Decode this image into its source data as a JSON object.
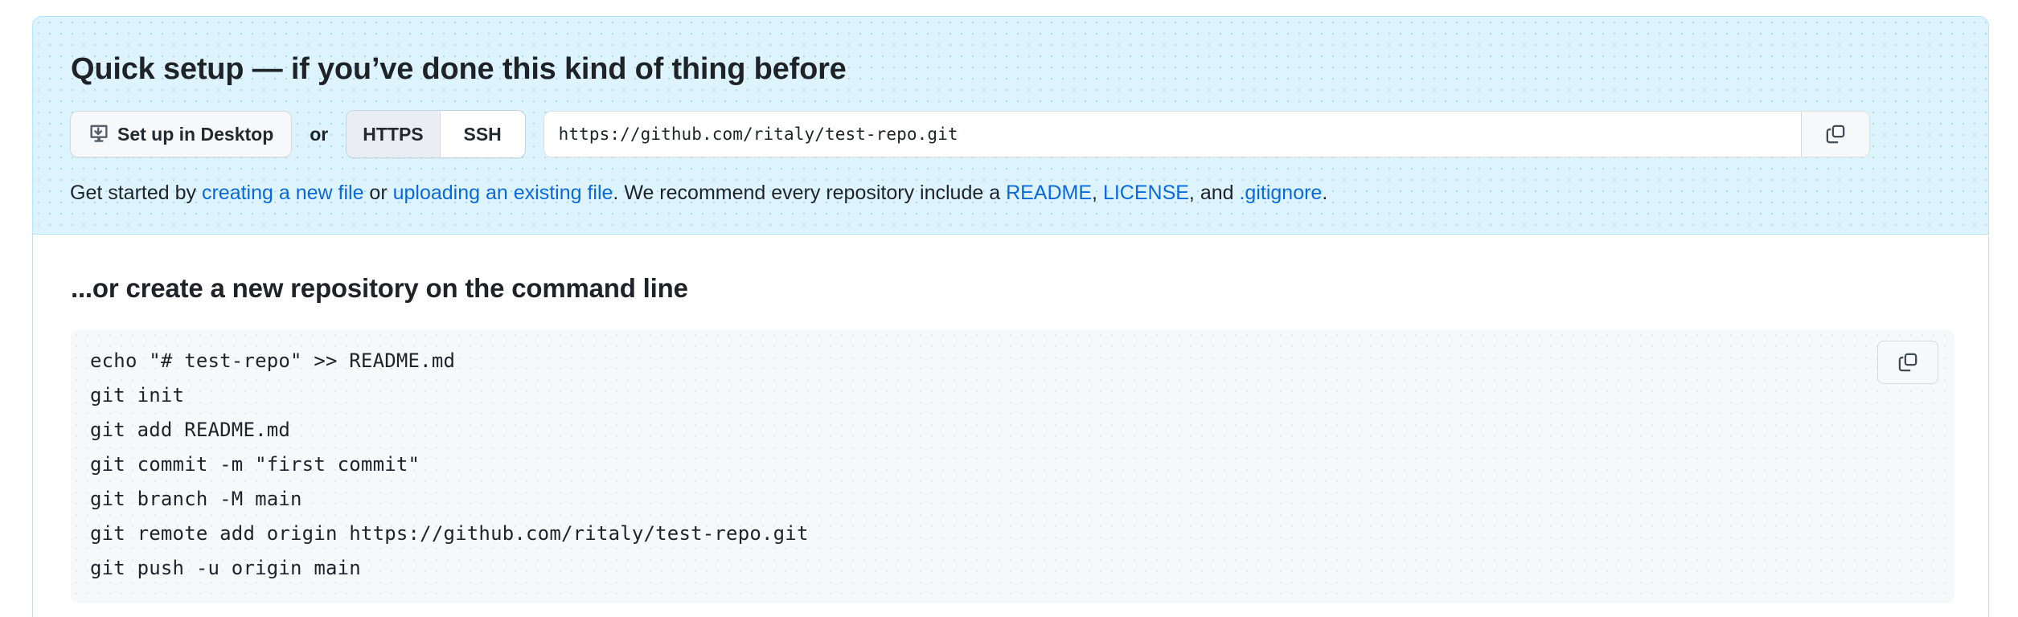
{
  "quick_setup": {
    "title": "Quick setup — if you’ve done this kind of thing before",
    "desktop_button": {
      "label": "Set up in Desktop",
      "icon": "desktop-download-icon"
    },
    "or_label": "or",
    "protocols": [
      {
        "label": "HTTPS",
        "selected": true
      },
      {
        "label": "SSH",
        "selected": false
      }
    ],
    "clone_url": "https://github.com/ritaly/test-repo.git",
    "copy_icon": "copy-icon",
    "get_started": {
      "prefix": "Get started by ",
      "link_create": "creating a new file",
      "mid_or": " or ",
      "link_upload": "uploading an existing file",
      "recommend": ". We recommend every repository include a ",
      "link_readme": "README",
      "sep1": ", ",
      "link_license": "LICENSE",
      "sep2": ", and ",
      "link_gitignore": ".gitignore",
      "suffix": "."
    }
  },
  "command_line": {
    "title": "...or create a new repository on the command line",
    "copy_icon": "copy-icon",
    "lines": [
      "echo \"# test-repo\" >> README.md",
      "git init",
      "git add README.md",
      "git commit -m \"first commit\"",
      "git branch -M main",
      "git remote add origin https://github.com/ritaly/test-repo.git",
      "git push -u origin main"
    ]
  },
  "colors": {
    "panel_bg": "#ddf4ff",
    "panel_border": "#b6e3ff",
    "link": "#0969da",
    "text": "#1f2328",
    "code_bg": "#f6f8fa",
    "selected_toggle": "#eaeef2"
  }
}
